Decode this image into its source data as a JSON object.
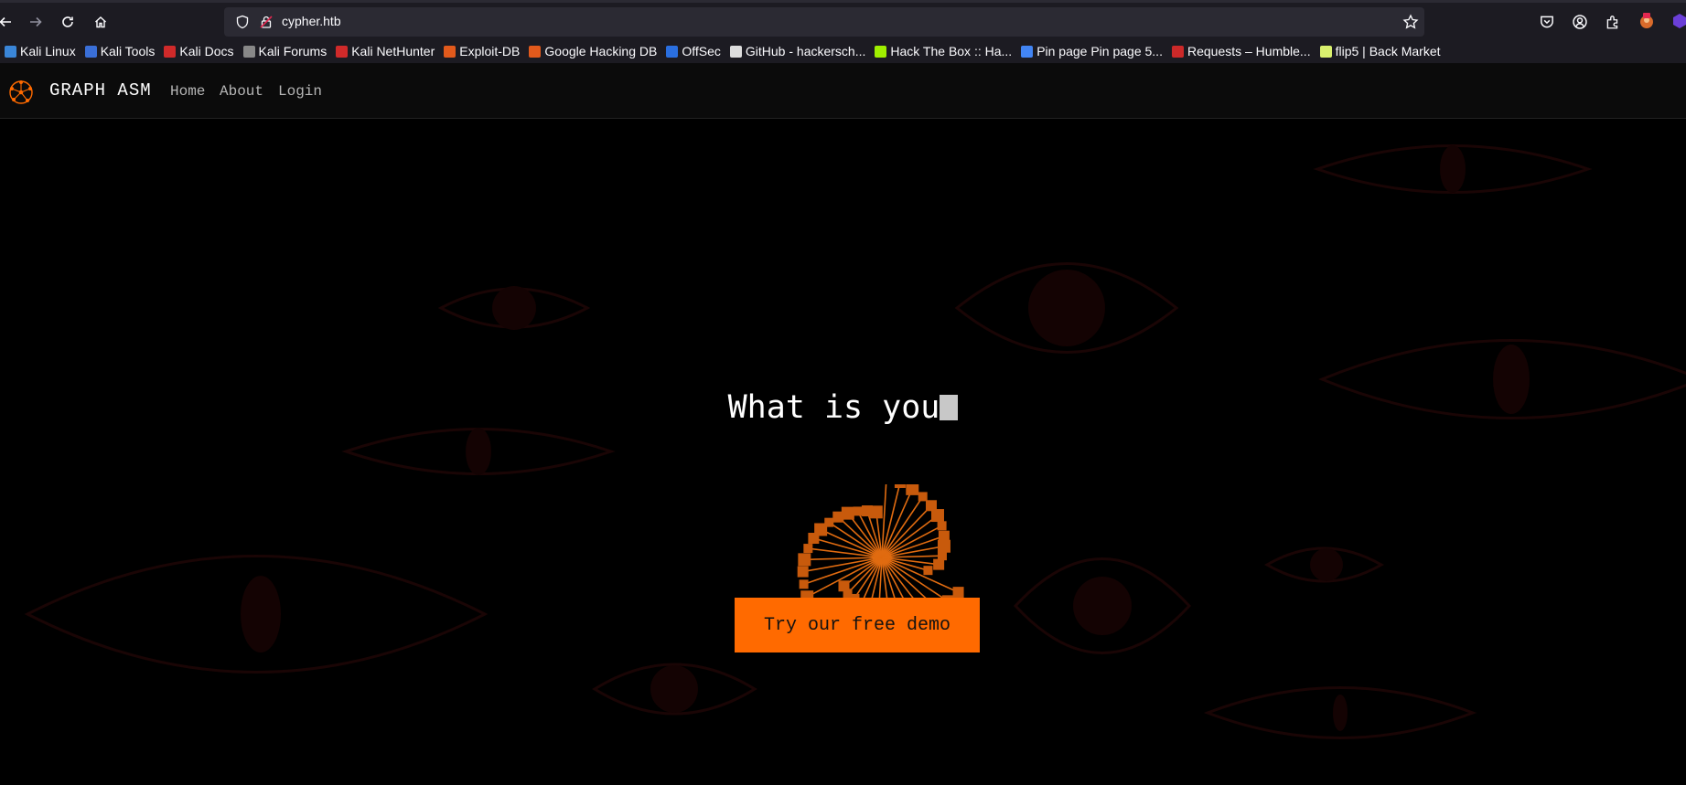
{
  "browser": {
    "url": "cypher.htb",
    "nav_icons": [
      "back-icon",
      "forward-icon",
      "reload-icon",
      "home-icon"
    ],
    "right_icons": [
      "pocket-icon",
      "account-icon",
      "extensions-icon",
      "profile-avatar-icon",
      "extension-icon"
    ]
  },
  "bookmarks": [
    {
      "label": "Kali Linux",
      "color": "#3a86d8"
    },
    {
      "label": "Kali Tools",
      "color": "#3a6fd8"
    },
    {
      "label": "Kali Docs",
      "color": "#d02a2a"
    },
    {
      "label": "Kali Forums",
      "color": "#888888"
    },
    {
      "label": "Kali NetHunter",
      "color": "#d02a2a"
    },
    {
      "label": "Exploit-DB",
      "color": "#e25a1c"
    },
    {
      "label": "Google Hacking DB",
      "color": "#e25a1c"
    },
    {
      "label": "OffSec",
      "color": "#2a6fe0"
    },
    {
      "label": "GitHub - hackersch...",
      "color": "#dddddd"
    },
    {
      "label": "Hack The Box :: Ha...",
      "color": "#9fef00"
    },
    {
      "label": "Pin page Pin page 5...",
      "color": "#4285f4"
    },
    {
      "label": "Requests – Humble...",
      "color": "#cc2929"
    },
    {
      "label": "flip5 | Back Market",
      "color": "#d9f06e"
    }
  ],
  "site": {
    "brand": "GRAPH ASM",
    "nav": [
      "Home",
      "About",
      "Login"
    ],
    "headline": "What is you",
    "cta": "Try our free demo",
    "accent_color": "#ff6a00"
  }
}
